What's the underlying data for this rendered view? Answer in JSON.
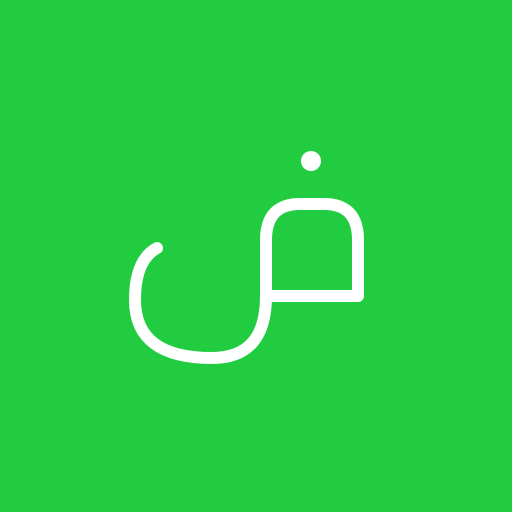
{
  "tile": {
    "background_color": "#22cc40",
    "glyph_color": "#ffffff",
    "glyph_text": "ض",
    "glyph_name": "arabic-letter-dad"
  }
}
